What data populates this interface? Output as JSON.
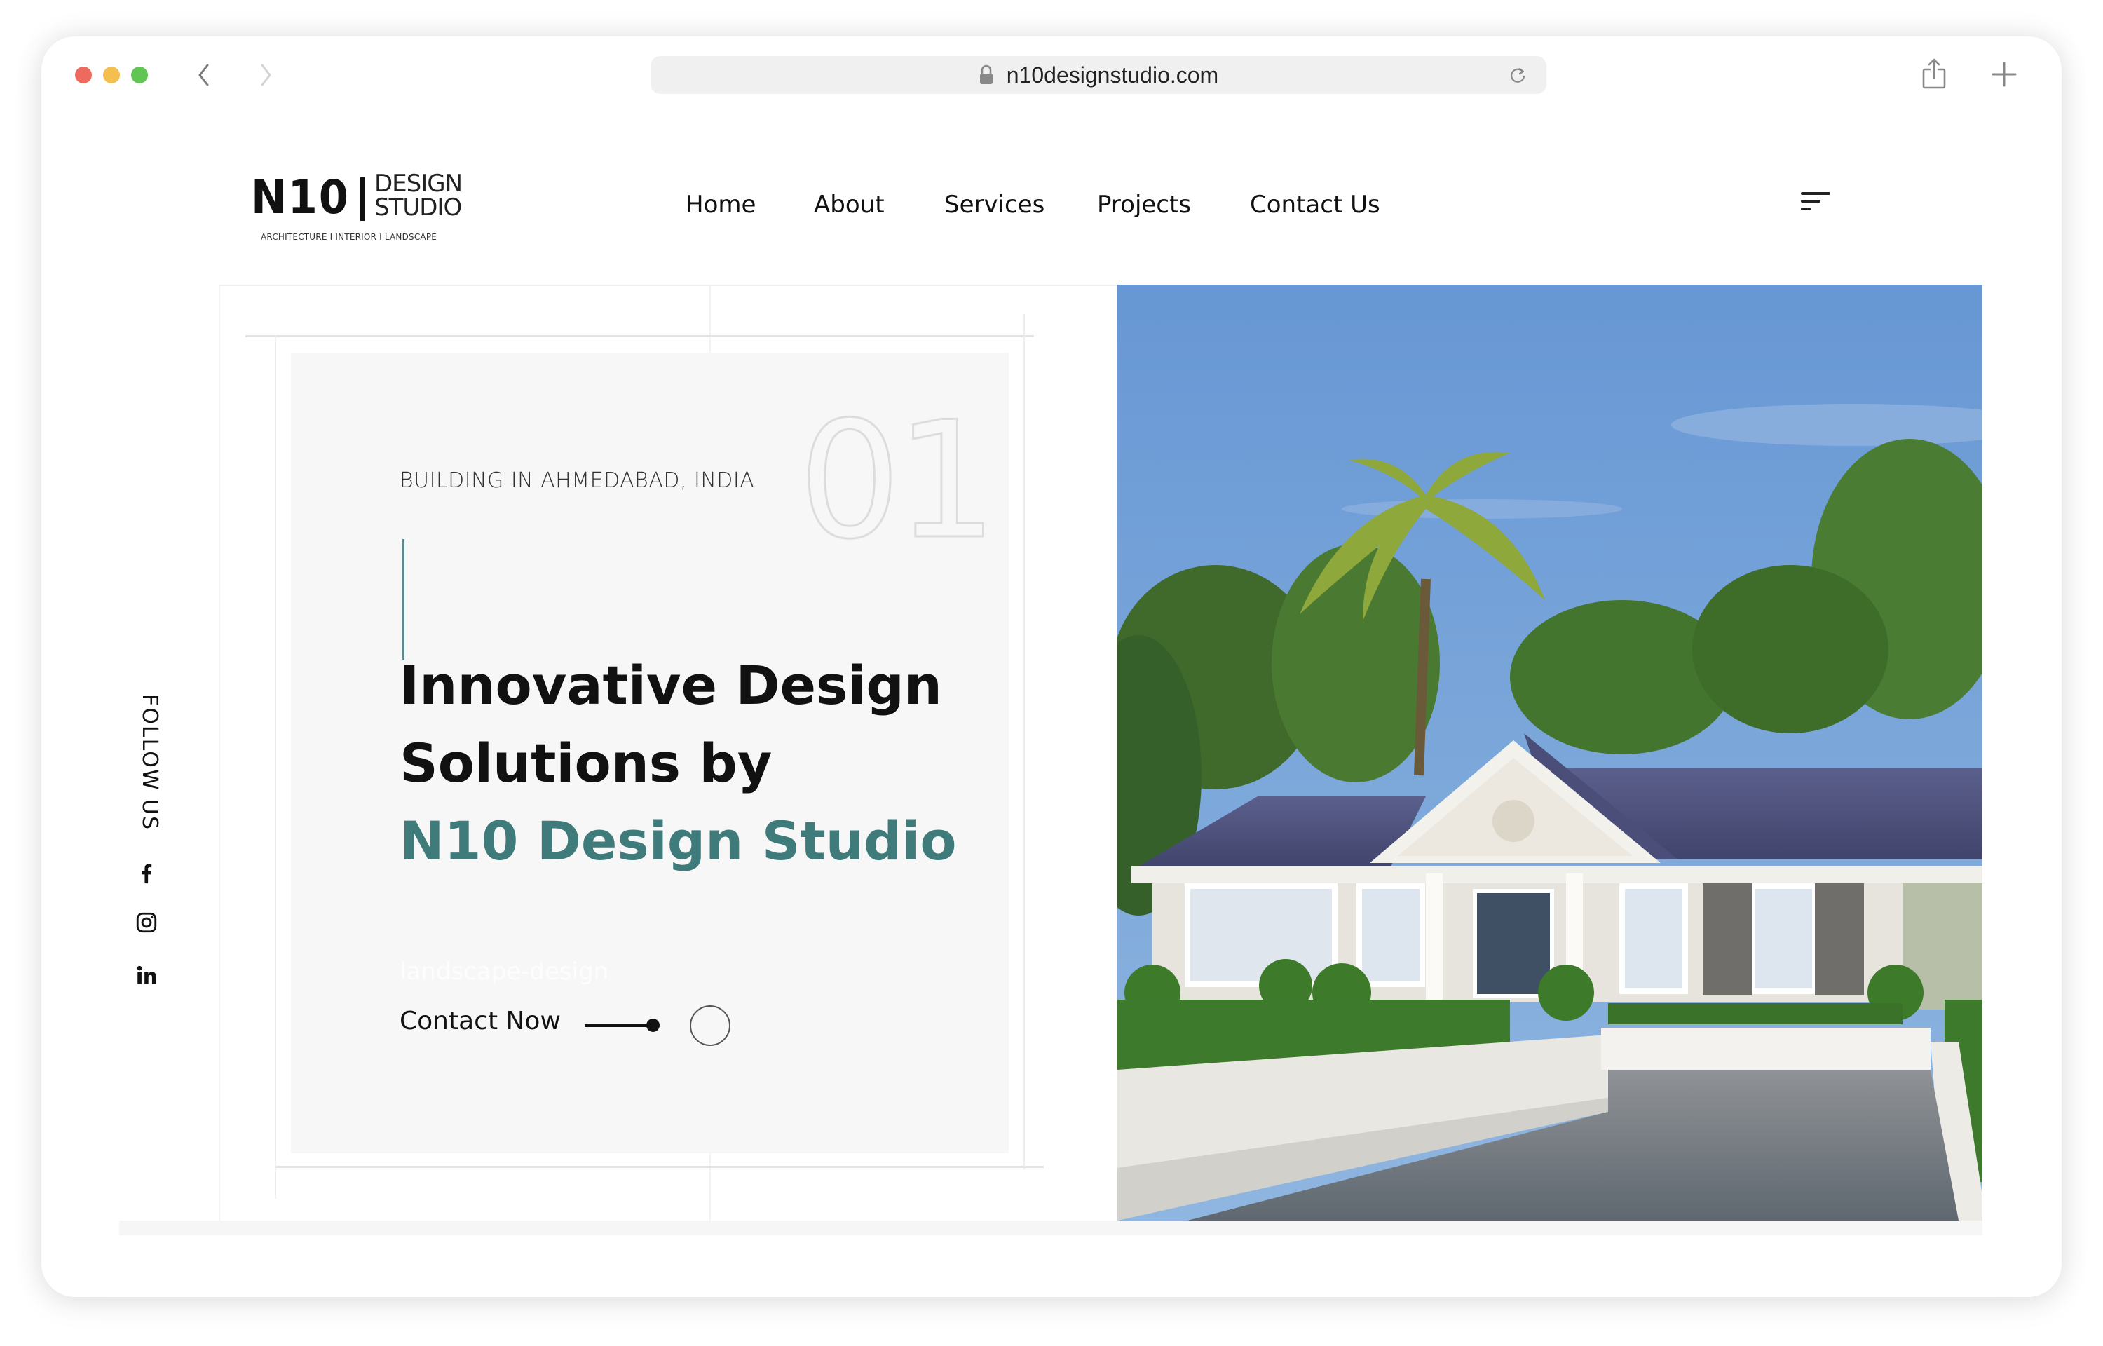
{
  "browser": {
    "url": "n10designstudio.com",
    "icons": [
      "back-chevron",
      "forward-chevron",
      "lock",
      "reload",
      "share",
      "new-tab-plus"
    ]
  },
  "site": {
    "logo": {
      "mark": "N10",
      "line1": "DESIGN",
      "line2": "STUDIO",
      "tagline": "ARCHITECTURE I INTERIOR I LANDSCAPE"
    },
    "nav": [
      {
        "label": "Home"
      },
      {
        "label": "About"
      },
      {
        "label": "Services"
      },
      {
        "label": "Projects"
      },
      {
        "label": "Contact Us"
      }
    ],
    "menu_icon": "hamburger-menu"
  },
  "hero": {
    "subtitle": "BUILDING IN AHMEDABAD, INDIA",
    "slide_number": "01",
    "heading_line1": "Innovative Design",
    "heading_line2": "Solutions by",
    "heading_accent": "N10 Design Studio",
    "faint_tag": "landscape-design",
    "cta_label": "Contact Now",
    "image_alt": "Render of single-storey villa with blue tiled roof, white pediment, palm trees and cobblestone driveway",
    "accent_color": "#3f7b7a"
  },
  "social": {
    "label": "FOLLOW US",
    "links": [
      {
        "name": "facebook"
      },
      {
        "name": "instagram"
      },
      {
        "name": "linkedin"
      }
    ]
  }
}
